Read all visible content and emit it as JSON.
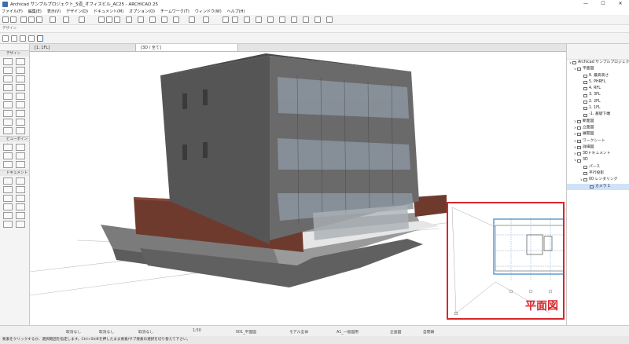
{
  "window": {
    "title": "Archicad サンプルプロジェクト_5道_オフィスビル_AC25 - ARCHICAD 25",
    "minimize": "—",
    "maximize": "☐",
    "close": "✕"
  },
  "menu": [
    "ファイル(F)",
    "編集(E)",
    "表示(V)",
    "デザイン(D)",
    "ドキュメント(M)",
    "オプション(O)",
    "チームワーク(T)",
    "ウィンドウ(W)",
    "ヘルプ(H)"
  ],
  "design_strip": "デザイン",
  "toolbox": {
    "sections": [
      {
        "label": "デザイン"
      },
      {
        "label": "ビューポイント"
      },
      {
        "label": "ドキュメント"
      }
    ]
  },
  "tabs": [
    {
      "label": "[1. 1FL]"
    },
    {
      "label": "[3D / 全て]"
    }
  ],
  "navigator": {
    "items": [
      {
        "label": "Archicad サンプルプロジェクト",
        "level": 0,
        "chev": "∨"
      },
      {
        "label": "平面図",
        "level": 1,
        "chev": "∨"
      },
      {
        "label": "6. 最高高さ",
        "level": 2,
        "chev": ""
      },
      {
        "label": "5. PHRFL",
        "level": 2,
        "chev": ""
      },
      {
        "label": "4. RFL",
        "level": 2,
        "chev": ""
      },
      {
        "label": "3. 3FL",
        "level": 2,
        "chev": ""
      },
      {
        "label": "2. 2FL",
        "level": 2,
        "chev": ""
      },
      {
        "label": "1. 1FL",
        "level": 2,
        "chev": ""
      },
      {
        "label": "-1. 基礎下端",
        "level": 2,
        "chev": ""
      },
      {
        "label": "断面図",
        "level": 1,
        "chev": ">"
      },
      {
        "label": "立面図",
        "level": 1,
        "chev": ">"
      },
      {
        "label": "展開図",
        "level": 1,
        "chev": ">"
      },
      {
        "label": "ワークシート",
        "level": 1,
        "chev": ">"
      },
      {
        "label": "詳細図",
        "level": 1,
        "chev": ">"
      },
      {
        "label": "3Dドキュメント",
        "level": 1,
        "chev": ">"
      },
      {
        "label": "3D",
        "level": 1,
        "chev": "∨"
      },
      {
        "label": "パース",
        "level": 2,
        "chev": ""
      },
      {
        "label": "平行投影",
        "level": 2,
        "chev": ""
      },
      {
        "label": "00 レンダリング",
        "level": 2,
        "chev": "∨"
      },
      {
        "label": "カメラ 1",
        "level": 3,
        "chev": "",
        "selected": true
      }
    ]
  },
  "statusbar": {
    "undo1": "取消なし",
    "undo2": "取消なし",
    "undo3": "取消なし",
    "scale": "1:50",
    "layer": "001_平面図",
    "model": "モデル全体",
    "pen": "A1_一般図用",
    "display": "企画図",
    "selected": "自閉鎖"
  },
  "hint": "要素をクリックするか、選択範囲を指定します。Ctrl+Shiftを押したまま要素/サブ要素の選択を切り替えて下さい。",
  "plan_overlay": {
    "label": "平面図",
    "accent": "#d7262b"
  }
}
